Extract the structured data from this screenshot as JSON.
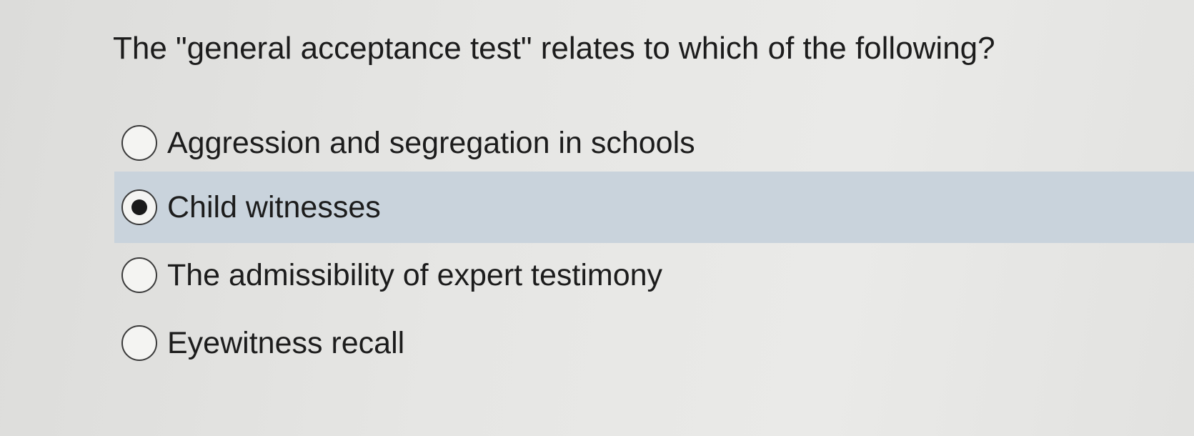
{
  "question": {
    "text": "The \"general acceptance test\" relates to which of the following?"
  },
  "options": [
    {
      "label": "Aggression and segregation in schools",
      "selected": false
    },
    {
      "label": "Child witnesses",
      "selected": true
    },
    {
      "label": "The admissibility of expert testimony",
      "selected": false
    },
    {
      "label": "Eyewitness recall",
      "selected": false
    }
  ],
  "colors": {
    "selected_highlight": "#c9d3dc",
    "background": "#e4e4e2",
    "text": "#1c1c1c"
  }
}
